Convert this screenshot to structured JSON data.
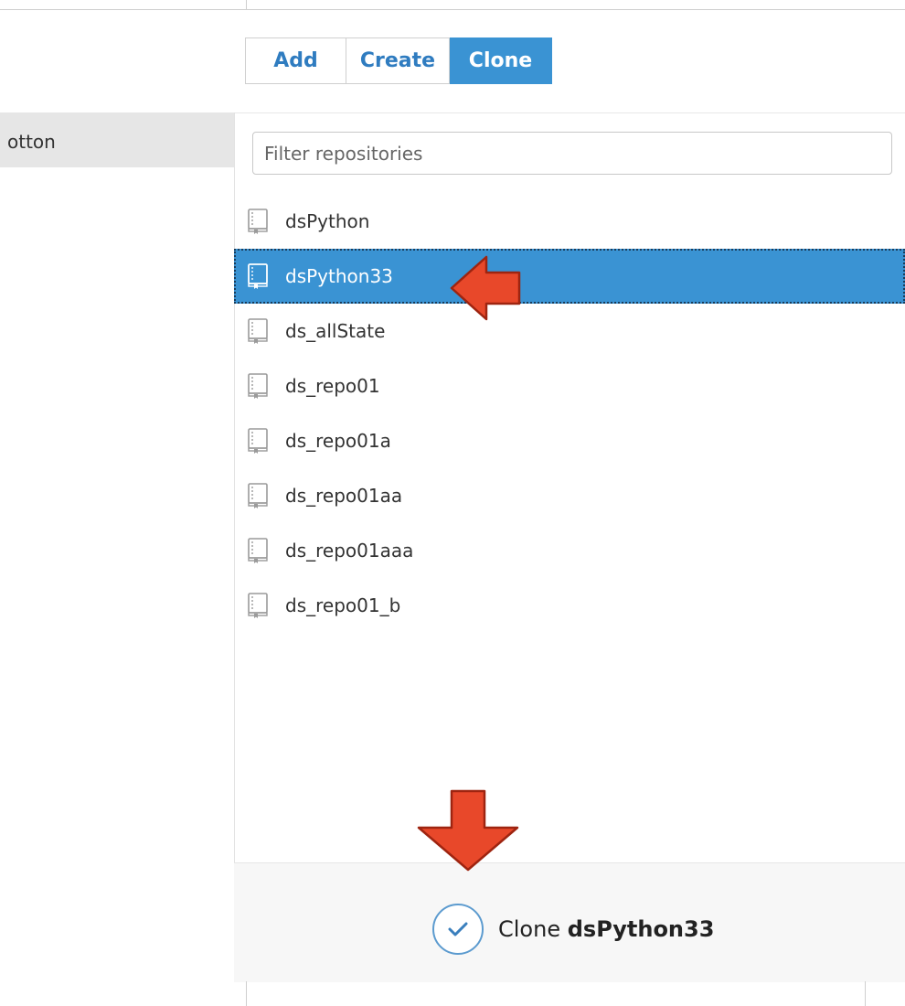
{
  "sidebar": {
    "selected_label": "otton"
  },
  "tabs": [
    {
      "label": "Add",
      "active": false
    },
    {
      "label": "Create",
      "active": false
    },
    {
      "label": "Clone",
      "active": true
    }
  ],
  "filter": {
    "placeholder": "Filter repositories",
    "value": ""
  },
  "repositories": [
    {
      "name": "dsPython",
      "selected": false
    },
    {
      "name": "dsPython33",
      "selected": true
    },
    {
      "name": "ds_allState",
      "selected": false
    },
    {
      "name": "ds_repo01",
      "selected": false
    },
    {
      "name": "ds_repo01a",
      "selected": false
    },
    {
      "name": "ds_repo01aa",
      "selected": false
    },
    {
      "name": "ds_repo01aaa",
      "selected": false
    },
    {
      "name": "ds_repo01_b",
      "selected": false
    }
  ],
  "footer": {
    "action_prefix": "Clone",
    "action_target": "dsPython33"
  },
  "colors": {
    "accent": "#3a93d3",
    "tab_text": "#2f7cc0",
    "annotation_arrow": "#e8482a"
  },
  "icons": {
    "repo": "repo-book-icon",
    "check": "check-icon",
    "annotation": "arrow-icon"
  }
}
